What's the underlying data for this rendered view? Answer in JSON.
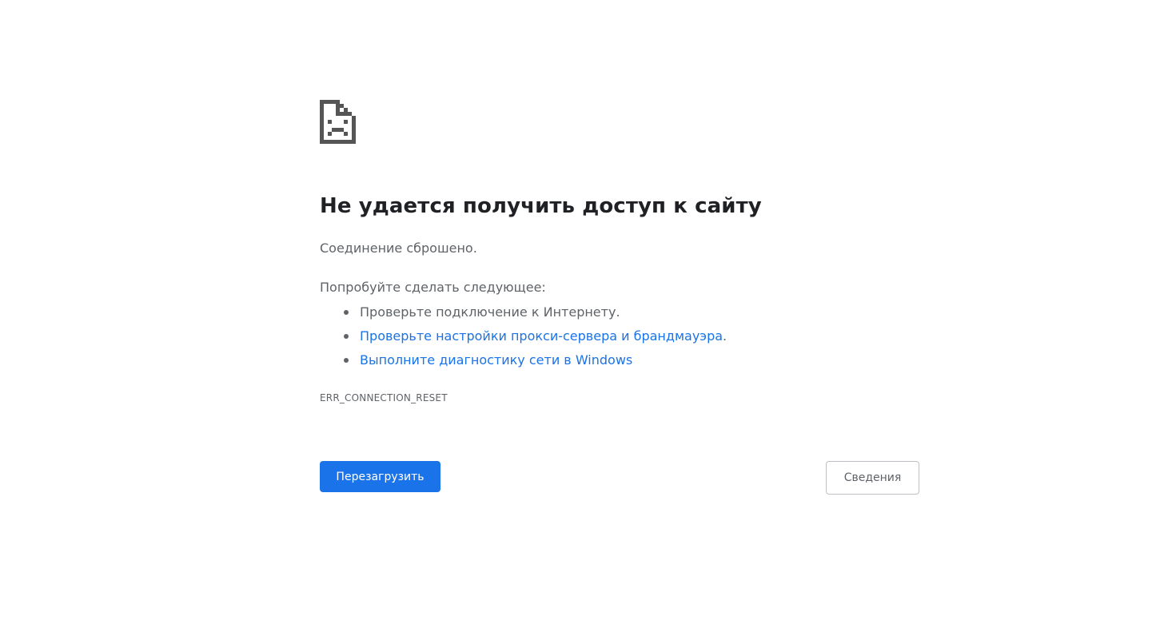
{
  "error": {
    "icon": "sad-document-icon",
    "title": "Не удается получить доступ к сайту",
    "summary": "Соединение сброшено.",
    "suggestions_heading": "Попробуйте сделать следующее:",
    "suggestions": [
      {
        "text": "Проверьте подключение к Интернету.",
        "is_link": false
      },
      {
        "link_text": "Проверьте настройки прокси-сервера и брандмауэра",
        "suffix": ".",
        "is_link": true
      },
      {
        "link_text": "Выполните диагностику сети в Windows",
        "suffix": "",
        "is_link": true
      }
    ],
    "code": "ERR_CONNECTION_RESET"
  },
  "buttons": {
    "reload_label": "Перезагрузить",
    "details_label": "Сведения"
  },
  "colors": {
    "accent": "#1a73e8",
    "title": "#202124",
    "text": "#5f6368",
    "icon": "#555555"
  }
}
